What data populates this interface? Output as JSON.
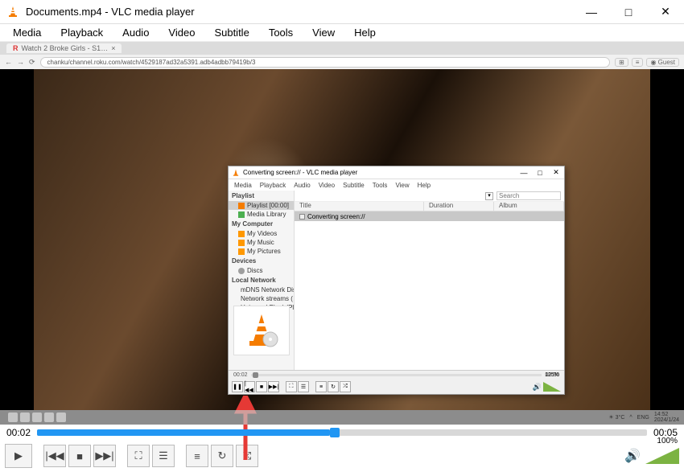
{
  "window": {
    "title": "Documents.mp4 - VLC media player",
    "min": "—",
    "max": "□",
    "close": "✕"
  },
  "menu": [
    "Media",
    "Playback",
    "Audio",
    "Video",
    "Subtitle",
    "Tools",
    "View",
    "Help"
  ],
  "browser": {
    "tab": "Watch 2 Broke Girls - S1…",
    "url": "chanku/channel.roku.com/watch/4529187ad32a5391.adb4adbb79419b/3",
    "guest": "Guest"
  },
  "inner": {
    "title": "Converting screen:// - VLC media player",
    "menu": [
      "Media",
      "Playback",
      "Audio",
      "Video",
      "Subtitle",
      "Tools",
      "View",
      "Help"
    ],
    "sidebar": {
      "playlist_hdr": "Playlist",
      "playlist": "Playlist [00:00]",
      "media_library": "Media Library",
      "computer_hdr": "My Computer",
      "my_videos": "My Videos",
      "my_music": "My Music",
      "my_pictures": "My Pictures",
      "devices_hdr": "Devices",
      "discs": "Discs",
      "network_hdr": "Local Network",
      "mdns": "mDNS Network Dis…",
      "streams": "Network streams (…",
      "upnp": "Universal Plug'n'Pla…"
    },
    "search_placeholder": "Search",
    "columns": {
      "title": "Title",
      "duration": "Duration",
      "album": "Album"
    },
    "row_title": "Converting screen://",
    "time_cur": "00:02",
    "time_tot": "00:00",
    "volume": "125%"
  },
  "taskbar": {
    "temp": "3°C",
    "lang": "ENG",
    "time": "14:52",
    "date": "2024/1/24"
  },
  "seek": {
    "current": "00:02",
    "total": "00:05"
  },
  "main_volume": "100%"
}
